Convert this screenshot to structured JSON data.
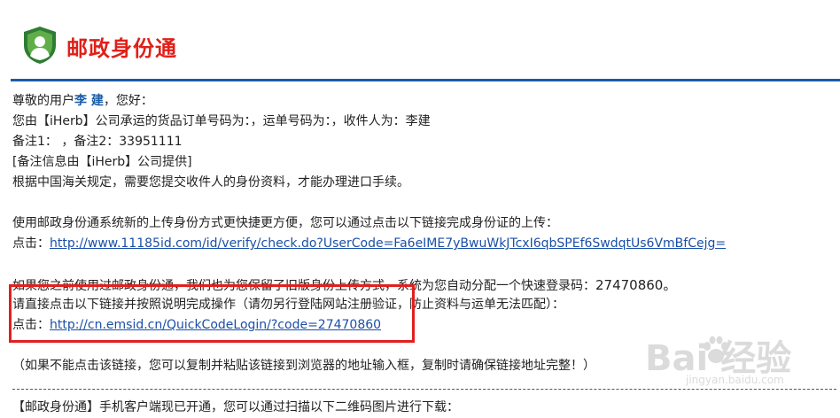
{
  "header": {
    "brand": "邮政身份通",
    "colors": {
      "brand_red": "#e0201a",
      "shield_green": "#2e7d32",
      "rule_blue": "#1a5ca8",
      "box_red": "#e02020"
    }
  },
  "email": {
    "greeting_prefix": "尊敬的用户",
    "user_name": "李 建",
    "greeting_suffix": "，您好：",
    "line_order": "您由【iHerb】公司承运的货品订单号码为：，运单号码为：，收件人为：李建",
    "line_remark": "备注1：  ，备注2：33951111",
    "line_remark_source": "[备注信息由【iHerb】公司提供]",
    "line_customs": "根据中国海关规定，需要您提交收件人的身份资料，才能办理进口手续。",
    "new_method_intro": "使用邮政身份通系统新的上传身份方式更快捷更方便，您可以通过点击以下链接完成身份证的上传：",
    "click_label": "点击：",
    "new_method_url": "http://www.11185id.com/id/verify/check.do?UserCode=Fa6eIME7yBwuWkJTcxI6qbSPEf6SwdqtUs6VmBfCejg=",
    "old_method_intro": "如果您之前使用过邮政身份通，我们也为您保留了旧版身份上传方式，系统为您自动分配一个快速登录码：",
    "quick_code": "27470860。",
    "old_method_instruction": "请直接点击以下链接并按照说明完成操作（请勿另行登陆网站注册验证，防止资料与运单无法匹配）：",
    "click_label_2": "点击：",
    "old_method_url": "http://cn.emsid.cn/QuickCodeLogin/?code=27470860",
    "copy_hint": "（如果不能点击该链接，您可以复制并粘贴该链接到浏览器的地址输入框，复制时请确保链接地址完整！）",
    "mobile_notice": "【邮政身份通】手机客户端现已开通，您可以通过扫描以下二维码图片进行下载："
  },
  "watermark": {
    "logo_text": "Bai  经验",
    "sub_text": "jingyan.baidu.com"
  }
}
